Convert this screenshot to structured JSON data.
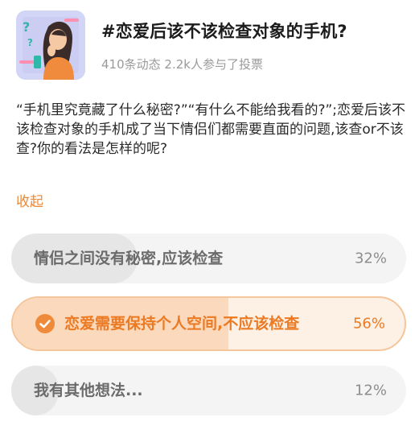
{
  "topic": {
    "title": "#恋爱后该不该检查对象的手机?",
    "meta": "410条动态 2.2k人参与了投票"
  },
  "description": "“手机里究竟藏了什么秘密?”“有什么不能给我看的?”;恋爱后该不该检查对象的手机成了当下情侣们都需要直面的问题,该查or不该查?你的看法是怎样的呢?",
  "collapse_label": "收起",
  "poll": {
    "options": [
      {
        "label": "情侣之间没有秘密,应该检查",
        "percent_text": "32%",
        "percent": 32,
        "selected": false
      },
      {
        "label": "恋爱需要保持个人空间,不应该检查",
        "percent_text": "56%",
        "percent": 56,
        "selected": true
      },
      {
        "label": "我有其他想法...",
        "percent_text": "12%",
        "percent": 12,
        "selected": false
      }
    ]
  },
  "colors": {
    "accent": "#ec7a23",
    "accent_fill": "#fbd9bc",
    "neutral_fill": "#e6e6e6"
  }
}
